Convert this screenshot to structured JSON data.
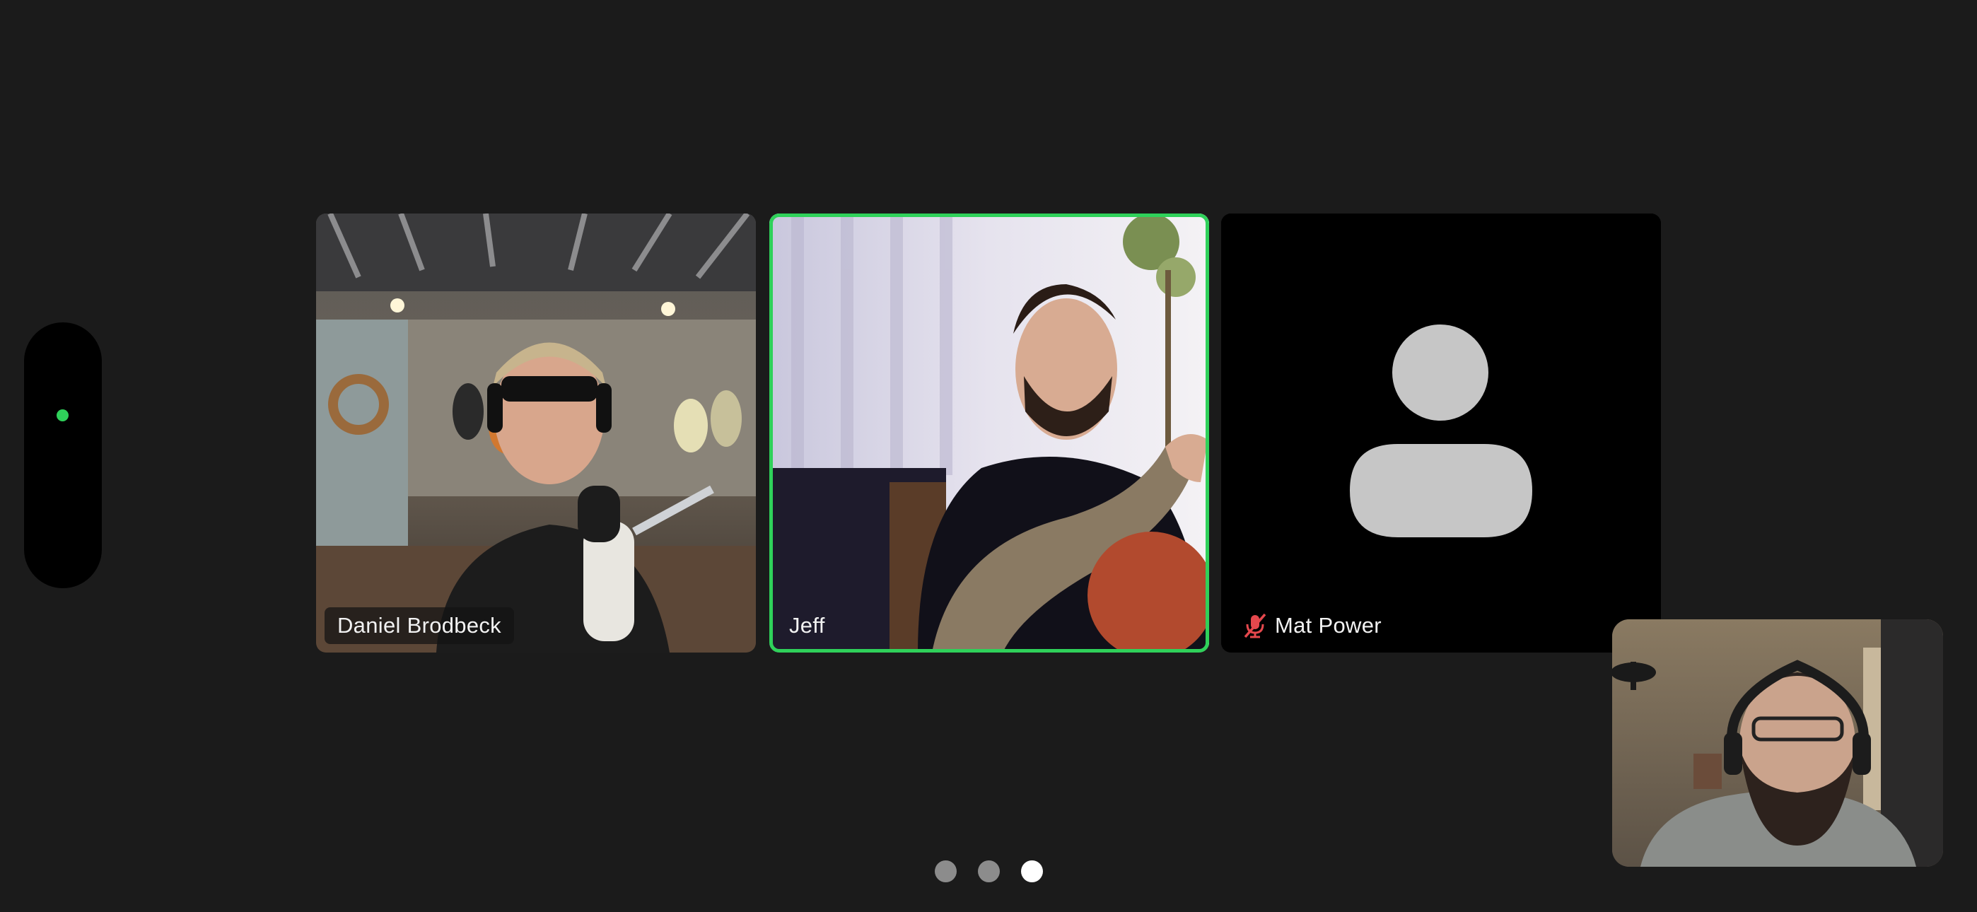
{
  "participants": [
    {
      "name": "Daniel Brodbeck",
      "muted": false,
      "active_speaker": false,
      "video": true
    },
    {
      "name": "Jeff",
      "muted": false,
      "active_speaker": true,
      "video": true
    },
    {
      "name": "Mat Power",
      "muted": true,
      "active_speaker": false,
      "video": false
    }
  ],
  "self_view": {
    "video": true
  },
  "pagination": {
    "pages": 3,
    "current": 3
  },
  "colors": {
    "background": "#1b1b1b",
    "active_speaker": "#2fd15a",
    "muted": "#e5484d",
    "avatar": "#c6c6c6"
  }
}
